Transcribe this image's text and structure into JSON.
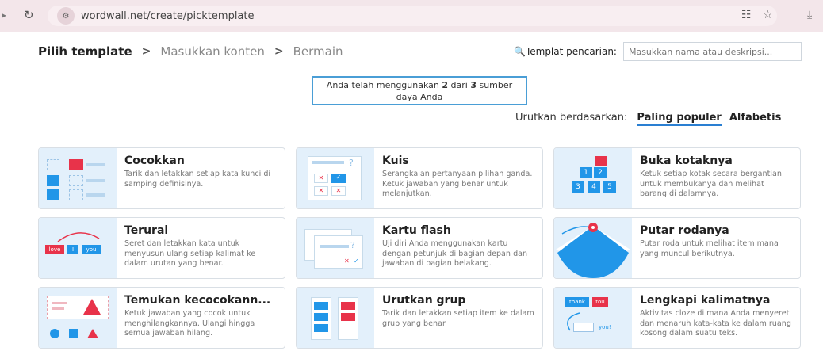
{
  "browser": {
    "url": "wordwall.net/create/picktemplate"
  },
  "breadcrumb": {
    "step1": "Pilih template",
    "step2": "Masukkan konten",
    "step3": "Bermain",
    "separator": ">"
  },
  "search": {
    "label": "Templat pencarian:",
    "placeholder": "Masukkan nama atau deskripsi..."
  },
  "usage": {
    "line1": "Anda telah menggunakan",
    "used": "2",
    "middle": "dari",
    "total": "3",
    "line1_end": "sumber",
    "line2": "daya Anda"
  },
  "sort": {
    "label": "Urutkan berdasarkan:",
    "option_popular": "Paling populer",
    "option_alpha": "Alfabetis"
  },
  "templates": [
    {
      "title": "Cocokkan",
      "desc": "Tarik dan letakkan setiap kata kunci di samping definisinya."
    },
    {
      "title": "Kuis",
      "desc": "Serangkaian pertanyaan pilihan ganda. Ketuk jawaban yang benar untuk melanjutkan."
    },
    {
      "title": "Buka kotaknya",
      "desc": "Ketuk setiap kotak secara bergantian untuk membukanya dan melihat barang di dalamnya."
    },
    {
      "title": "Terurai",
      "desc": "Seret dan letakkan kata untuk menyusun ulang setiap kalimat ke dalam urutan yang benar."
    },
    {
      "title": "Kartu flash",
      "desc": "Uji diri Anda menggunakan kartu dengan petunjuk di bagian depan dan jawaban di bagian belakang."
    },
    {
      "title": "Putar rodanya",
      "desc": "Putar roda untuk melihat item mana yang muncul berikutnya."
    },
    {
      "title": "Temukan kecocokann...",
      "desc": "Ketuk jawaban yang cocok untuk menghilangkannya. Ulangi hingga semua jawaban hilang."
    },
    {
      "title": "Urutkan grup",
      "desc": "Tarik dan letakkan setiap item ke dalam grup yang benar."
    },
    {
      "title": "Lengkapi kalimatnya",
      "desc": "Aktivitas cloze di mana Anda menyeret dan menaruh kata-kata ke dalam ruang kosong dalam suatu teks."
    }
  ],
  "thumb_labels": {
    "box_numbers": [
      "1",
      "2",
      "3",
      "4",
      "5"
    ],
    "unjumble_words": [
      "love",
      "I",
      "you"
    ],
    "cloze_words": [
      "thank",
      "tou",
      "you!"
    ]
  },
  "colors": {
    "accent_blue": "#2196e8",
    "accent_red": "#e8334a",
    "thumb_bg": "#e3f0fb",
    "border_highlight": "#4a9ed6"
  }
}
